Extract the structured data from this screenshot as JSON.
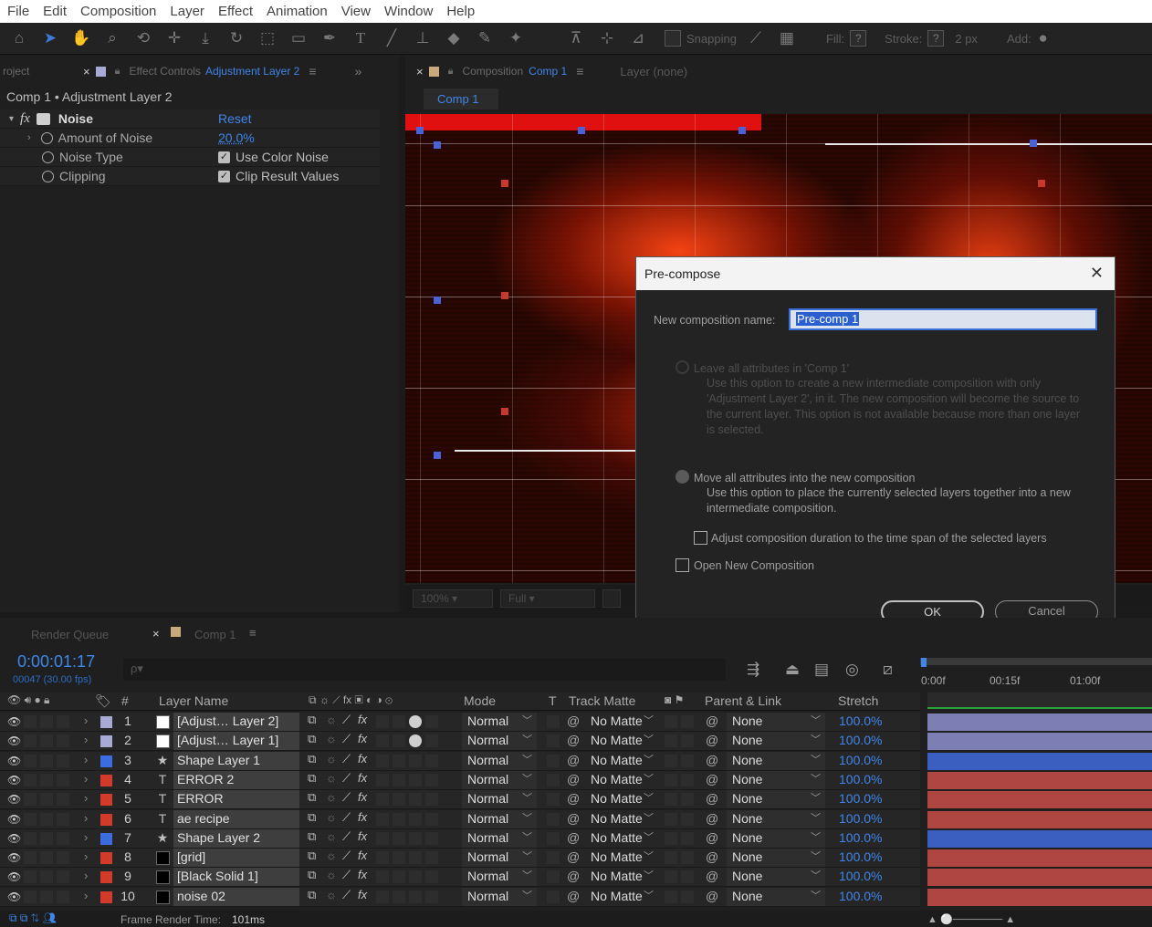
{
  "menu": [
    "File",
    "Edit",
    "Composition",
    "Layer",
    "Effect",
    "Animation",
    "View",
    "Window",
    "Help"
  ],
  "toolbar": {
    "snapping": "Snapping",
    "fill": "Fill:",
    "stroke": "Stroke:",
    "stroke_width": "2 px",
    "add": "Add:",
    "question": "?"
  },
  "effect_panel": {
    "project_tab": "roject",
    "tab_label": "Effect Controls",
    "tab_layer": "Adjustment Layer 2",
    "header": "Comp 1 • Adjustment Layer 2",
    "effect_name": "Noise",
    "reset": "Reset",
    "fx": "fx",
    "props": {
      "amount_label": "Amount of Noise",
      "amount_value": "20.0",
      "amount_unit": "%",
      "type_label": "Noise Type",
      "type_value": "Use Color Noise",
      "clip_label": "Clipping",
      "clip_value": "Clip Result Values"
    }
  },
  "comp_panel": {
    "tab_label": "Composition",
    "tab_comp": "Comp 1",
    "layer_tab": "Layer (none)",
    "subtab": "Comp 1",
    "zoom": "100%",
    "resolution": "Full"
  },
  "dialog": {
    "title": "Pre-compose",
    "name_label": "New composition name:",
    "name_value": "Pre-comp 1",
    "opt1_label": "Leave all attributes in 'Comp 1'",
    "opt1_desc": "Use this option to create a new intermediate composition with only 'Adjustment Layer 2', in it. The new composition will become the source to the current layer. This option is not available because more than one layer is selected.",
    "opt2_label": "Move all attributes into the new composition",
    "opt2_desc": "Use this option to place the currently selected layers together into a new intermediate composition.",
    "adjust_label": "Adjust composition duration to the time span of the selected layers",
    "open_label": "Open New Composition",
    "ok": "OK",
    "cancel": "Cancel"
  },
  "timeline": {
    "render_queue_tab": "Render Queue",
    "comp_tab": "Comp 1",
    "timecode": "0:00:01:17",
    "fps": "00047 (30.00 fps)",
    "search_placeholder": "ρ▾",
    "ruler": [
      "0:00f",
      "00:15f",
      "01:00f"
    ],
    "columns": {
      "hash": "#",
      "layer_name": "Layer Name",
      "mode": "Mode",
      "t": "T",
      "track_matte": "Track Matte",
      "parent": "Parent & Link",
      "stretch": "Stretch"
    },
    "layers": [
      {
        "num": "1",
        "type": "",
        "name": "[Adjust… Layer 2]",
        "mode": "Normal",
        "matte": "No Matte",
        "parent": "None",
        "stretch": "100.0%",
        "label": "#a9a9d6",
        "swatch": "#ffffff",
        "bar": "#7d7fb4"
      },
      {
        "num": "2",
        "type": "",
        "name": "[Adjust… Layer 1]",
        "mode": "Normal",
        "matte": "No Matte",
        "parent": "None",
        "stretch": "100.0%",
        "label": "#a9a9d6",
        "swatch": "#ffffff",
        "bar": "#7d7fb4"
      },
      {
        "num": "3",
        "type": "★",
        "name": "Shape Layer 1",
        "mode": "Normal",
        "matte": "No Matte",
        "parent": "None",
        "stretch": "100.0%",
        "label": "#3c6de0",
        "swatch": "",
        "bar": "#3a5fc0"
      },
      {
        "num": "4",
        "type": "T",
        "name": "ERROR 2",
        "mode": "Normal",
        "matte": "No Matte",
        "parent": "None",
        "stretch": "100.0%",
        "label": "#d33a2a",
        "swatch": "",
        "bar": "#b04642"
      },
      {
        "num": "5",
        "type": "T",
        "name": "ERROR",
        "mode": "Normal",
        "matte": "No Matte",
        "parent": "None",
        "stretch": "100.0%",
        "label": "#d33a2a",
        "swatch": "",
        "bar": "#b04642"
      },
      {
        "num": "6",
        "type": "T",
        "name": "ae recipe",
        "mode": "Normal",
        "matte": "No Matte",
        "parent": "None",
        "stretch": "100.0%",
        "label": "#d33a2a",
        "swatch": "",
        "bar": "#b04642"
      },
      {
        "num": "7",
        "type": "★",
        "name": "Shape Layer 2",
        "mode": "Normal",
        "matte": "No Matte",
        "parent": "None",
        "stretch": "100.0%",
        "label": "#3c6de0",
        "swatch": "",
        "bar": "#3a5fc0"
      },
      {
        "num": "8",
        "type": "",
        "name": "[grid]",
        "mode": "Normal",
        "matte": "No Matte",
        "parent": "None",
        "stretch": "100.0%",
        "label": "#d33a2a",
        "swatch": "#000000",
        "bar": "#b04642"
      },
      {
        "num": "9",
        "type": "",
        "name": "[Black Solid 1]",
        "mode": "Normal",
        "matte": "No Matte",
        "parent": "None",
        "stretch": "100.0%",
        "label": "#d33a2a",
        "swatch": "#000000",
        "bar": "#b04642"
      },
      {
        "num": "10",
        "type": "",
        "name": "noise 02",
        "mode": "Normal",
        "matte": "No Matte",
        "parent": "None",
        "stretch": "100.0%",
        "label": "#d33a2a",
        "swatch": "#000000",
        "bar": "#b04642"
      }
    ],
    "status_label": "Frame Render Time:",
    "status_value": "101ms"
  }
}
